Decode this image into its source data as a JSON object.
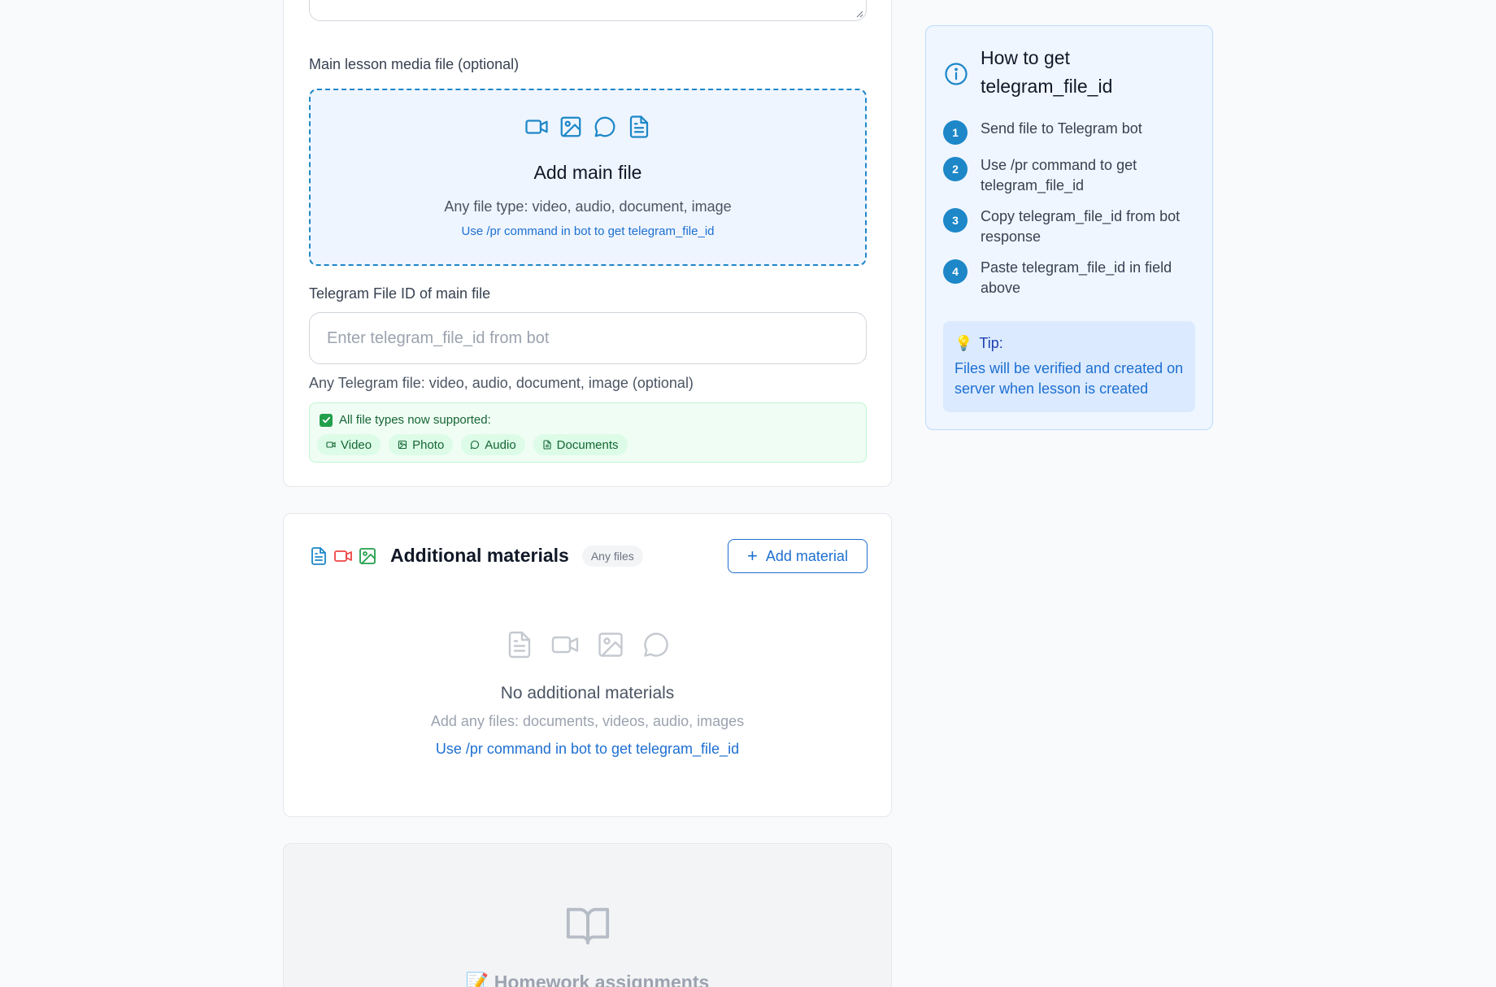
{
  "main_media": {
    "label": "Main lesson media file (optional)",
    "dropzone": {
      "title": "Add main file",
      "subtitle": "Any file type: video, audio, document, image",
      "hint": "Use /pr command in bot to get telegram_file_id",
      "icons": [
        "video-icon",
        "image-icon",
        "chat-bubble-icon",
        "document-icon"
      ]
    },
    "file_id_label": "Telegram File ID of main file",
    "file_id_value": "",
    "file_id_placeholder": "Enter telegram_file_id from bot",
    "helper": "Any Telegram file: video, audio, document, image (optional)",
    "supported": {
      "title": "All file types now supported:",
      "types": [
        "Video",
        "Photo",
        "Audio",
        "Documents"
      ]
    }
  },
  "materials": {
    "title": "Additional materials",
    "badge": "Any files",
    "add_button": "Add material",
    "empty_title": "No additional materials",
    "empty_subtitle": "Add any files: documents, videos, audio, images",
    "empty_link": "Use /pr command in bot to get telegram_file_id"
  },
  "homework": {
    "title": "📝 Homework assignments"
  },
  "info_panel": {
    "title": "How to get telegram_file_id",
    "steps": [
      {
        "num": "1",
        "text": "Send file to Telegram bot"
      },
      {
        "num": "2",
        "text": "Use /pr command to get telegram_file_id"
      },
      {
        "num": "3",
        "text": "Copy telegram_file_id from bot response"
      },
      {
        "num": "4",
        "text": "Paste telegram_file_id in field above"
      }
    ],
    "tip_title": "Tip:",
    "tip_text": "Files will be verified and created on server when lesson is created"
  },
  "colors": {
    "accent": "#1d6fd1",
    "accent_dark": "#1d87c8",
    "success": "#22a04b",
    "danger": "#ef4444",
    "page_bg": "#f8fafc"
  }
}
